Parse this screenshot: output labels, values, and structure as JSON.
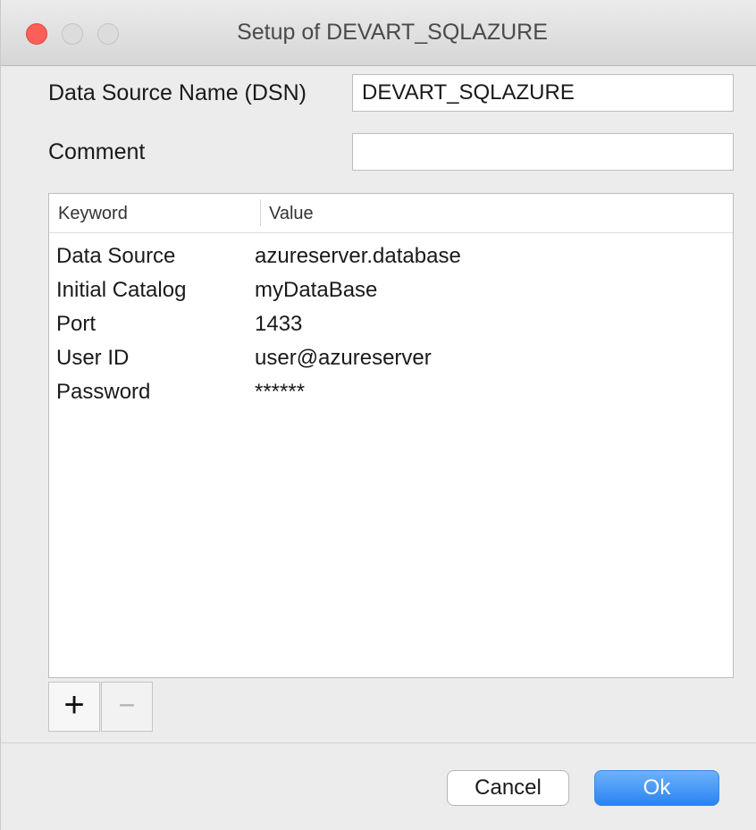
{
  "window": {
    "title": "Setup of DEVART_SQLAZURE"
  },
  "form": {
    "dsn_label": "Data Source Name (DSN)",
    "dsn_value": "DEVART_SQLAZURE",
    "comment_label": "Comment",
    "comment_value": ""
  },
  "table": {
    "headers": {
      "keyword": "Keyword",
      "value": "Value"
    },
    "rows": [
      {
        "keyword": "Data Source",
        "value": "azureserver.database"
      },
      {
        "keyword": "Initial Catalog",
        "value": "myDataBase"
      },
      {
        "keyword": "Port",
        "value": "1433"
      },
      {
        "keyword": "User ID",
        "value": "user@azureserver"
      },
      {
        "keyword": "Password",
        "value": "******"
      }
    ]
  },
  "buttons": {
    "add": "+",
    "remove": "−",
    "cancel": "Cancel",
    "ok": "Ok"
  },
  "colors": {
    "close": "#fc5f57",
    "accent": "#2b83f2"
  }
}
